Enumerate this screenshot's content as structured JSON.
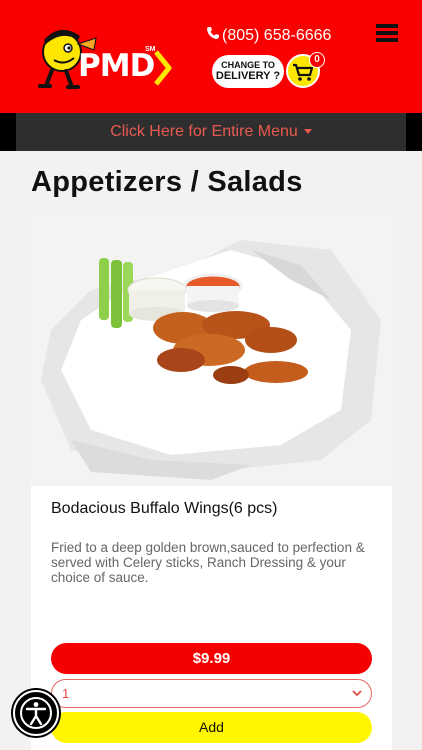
{
  "header": {
    "logo_text": "PMD",
    "logo_sm": "SM",
    "phone": "(805) 658-6666",
    "delivery_line1": "CHANGE TO",
    "delivery_line2": "DELIVERY ?",
    "cart_count": "0"
  },
  "menu_bar": {
    "label": "Click Here for Entire Menu"
  },
  "section": {
    "title": "Appetizers / Salads"
  },
  "product": {
    "name": "Bodacious Buffalo Wings(6 pcs)",
    "description": "Fried to a deep golden brown,sauced to perfection & served with Celery sticks, Ranch Dressing & your choice of sauce.",
    "price": "$9.99",
    "quantity": "1",
    "add_label": "Add"
  },
  "colors": {
    "brand_red": "#fb0000",
    "cart_yellow": "#ffe600",
    "add_yellow": "#fff600",
    "menu_text": "#e85a4f"
  },
  "icons": [
    "pmd-mascot-icon",
    "phone-icon",
    "cart-icon",
    "hamburger-icon",
    "caret-down-icon",
    "chevron-down-icon",
    "accessibility-icon"
  ]
}
